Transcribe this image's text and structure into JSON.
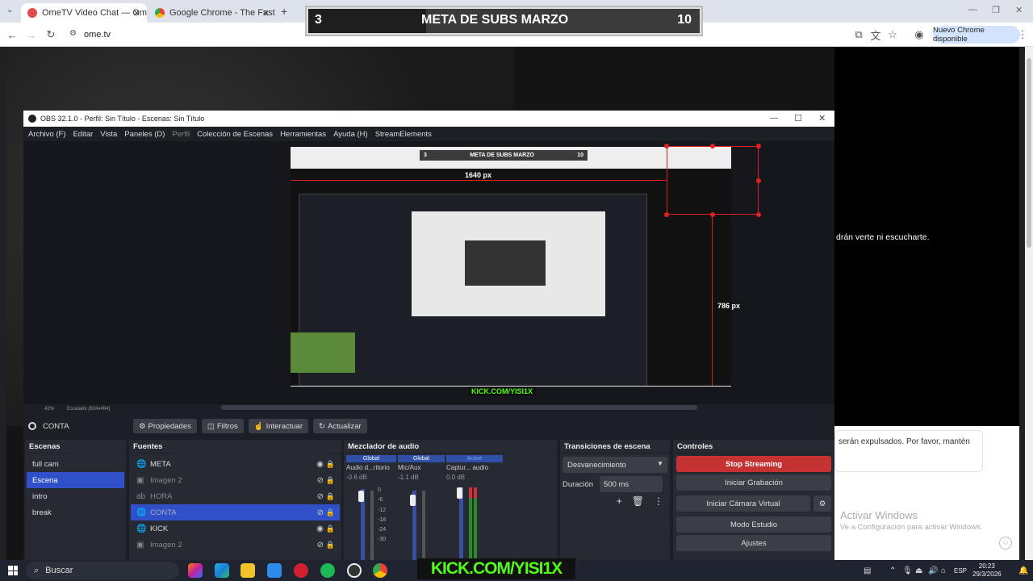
{
  "browser": {
    "tabs": [
      {
        "title": "OmeTV Video Chat — Omegle",
        "active": true
      },
      {
        "title": "Google Chrome - The Fast & Secure",
        "active": false
      }
    ],
    "url": "ome.tv",
    "update_button": "Nuevo Chrome disponible"
  },
  "overlay": {
    "goal_current": "3",
    "goal_title": "META DE SUBS MARZO",
    "goal_target": "10",
    "progress": 0.3
  },
  "page": {
    "side_text": "drán verte ni escucharte.",
    "card_text": "serán expulsados. Por favor, mantén",
    "activate_title": "Activar Windows",
    "activate_sub": "Ve a Configuración para activar Windows."
  },
  "obs": {
    "title": "OBS 32.1.0 - Perfil: Sin Título - Escenas: Sin Título",
    "menu": [
      "Archivo (F)",
      "Editar",
      "Vista",
      "Paneles (D)",
      "Perfil",
      "Colección de Escenas",
      "Herramientas",
      "Ayuda (H)",
      "StreamElements"
    ],
    "preview": {
      "mini_goal_current": "3",
      "mini_goal_title": "META DE SUBS MARZO",
      "mini_goal_target": "10",
      "width_label": "1640 px",
      "height_label": "786 px",
      "kick_label": "KICK.COM/YISI1X"
    },
    "zoom": "42%",
    "scaling": "Escalado (824x464)",
    "current_scene": "CONTA",
    "scene_buttons": [
      "Propiedades",
      "Filtros",
      "Interactuar",
      "Actualizar"
    ],
    "scenes_title": "Escenas",
    "scenes": [
      {
        "name": "full cam",
        "selected": false
      },
      {
        "name": "Escena",
        "selected": true
      },
      {
        "name": "intro",
        "selected": false
      },
      {
        "name": "break",
        "selected": false
      }
    ],
    "sources_title": "Fuentes",
    "sources": [
      {
        "name": "META",
        "icon": "globe-icon",
        "visible": true,
        "selected": false
      },
      {
        "name": "Imagen 2",
        "icon": "image-icon",
        "visible": false,
        "selected": false
      },
      {
        "name": "HORA",
        "icon": "text-icon",
        "visible": false,
        "selected": false
      },
      {
        "name": "CONTA",
        "icon": "globe-icon",
        "visible": false,
        "selected": true
      },
      {
        "name": "KICK",
        "icon": "globe-icon",
        "visible": true,
        "selected": false
      },
      {
        "name": "Imagen 2",
        "icon": "image-icon",
        "visible": false,
        "selected": false
      }
    ],
    "mixer_title": "Mezclador de audio",
    "mixer": [
      {
        "group": "Global",
        "name": "Audio d...ritorio",
        "db": "-0.6 dB"
      },
      {
        "group": "Global",
        "name": "Mic/Aux",
        "db": "-1.1 dB"
      },
      {
        "group": "Active",
        "name": "Captur... audio",
        "db": "0.0 dB"
      }
    ],
    "meter_ticks": [
      "0",
      "-6",
      "-12",
      "-18",
      "-24",
      "-30"
    ],
    "transitions_title": "Transiciones de escena",
    "transition": "Desvanecimiento",
    "duration_label": "Duración",
    "duration": "500 ms",
    "controls_title": "Controles",
    "controls": [
      "Stop Streaming",
      "Iniciar Grabación",
      "Iniciar Cámara Virtual",
      "Modo Estudio",
      "Ajustes"
    ]
  },
  "taskbar": {
    "search": "Buscar",
    "kick": "KICK.COM/YISI1X",
    "lang": "ESP",
    "time": "20:23",
    "date": "29/3/2026"
  }
}
